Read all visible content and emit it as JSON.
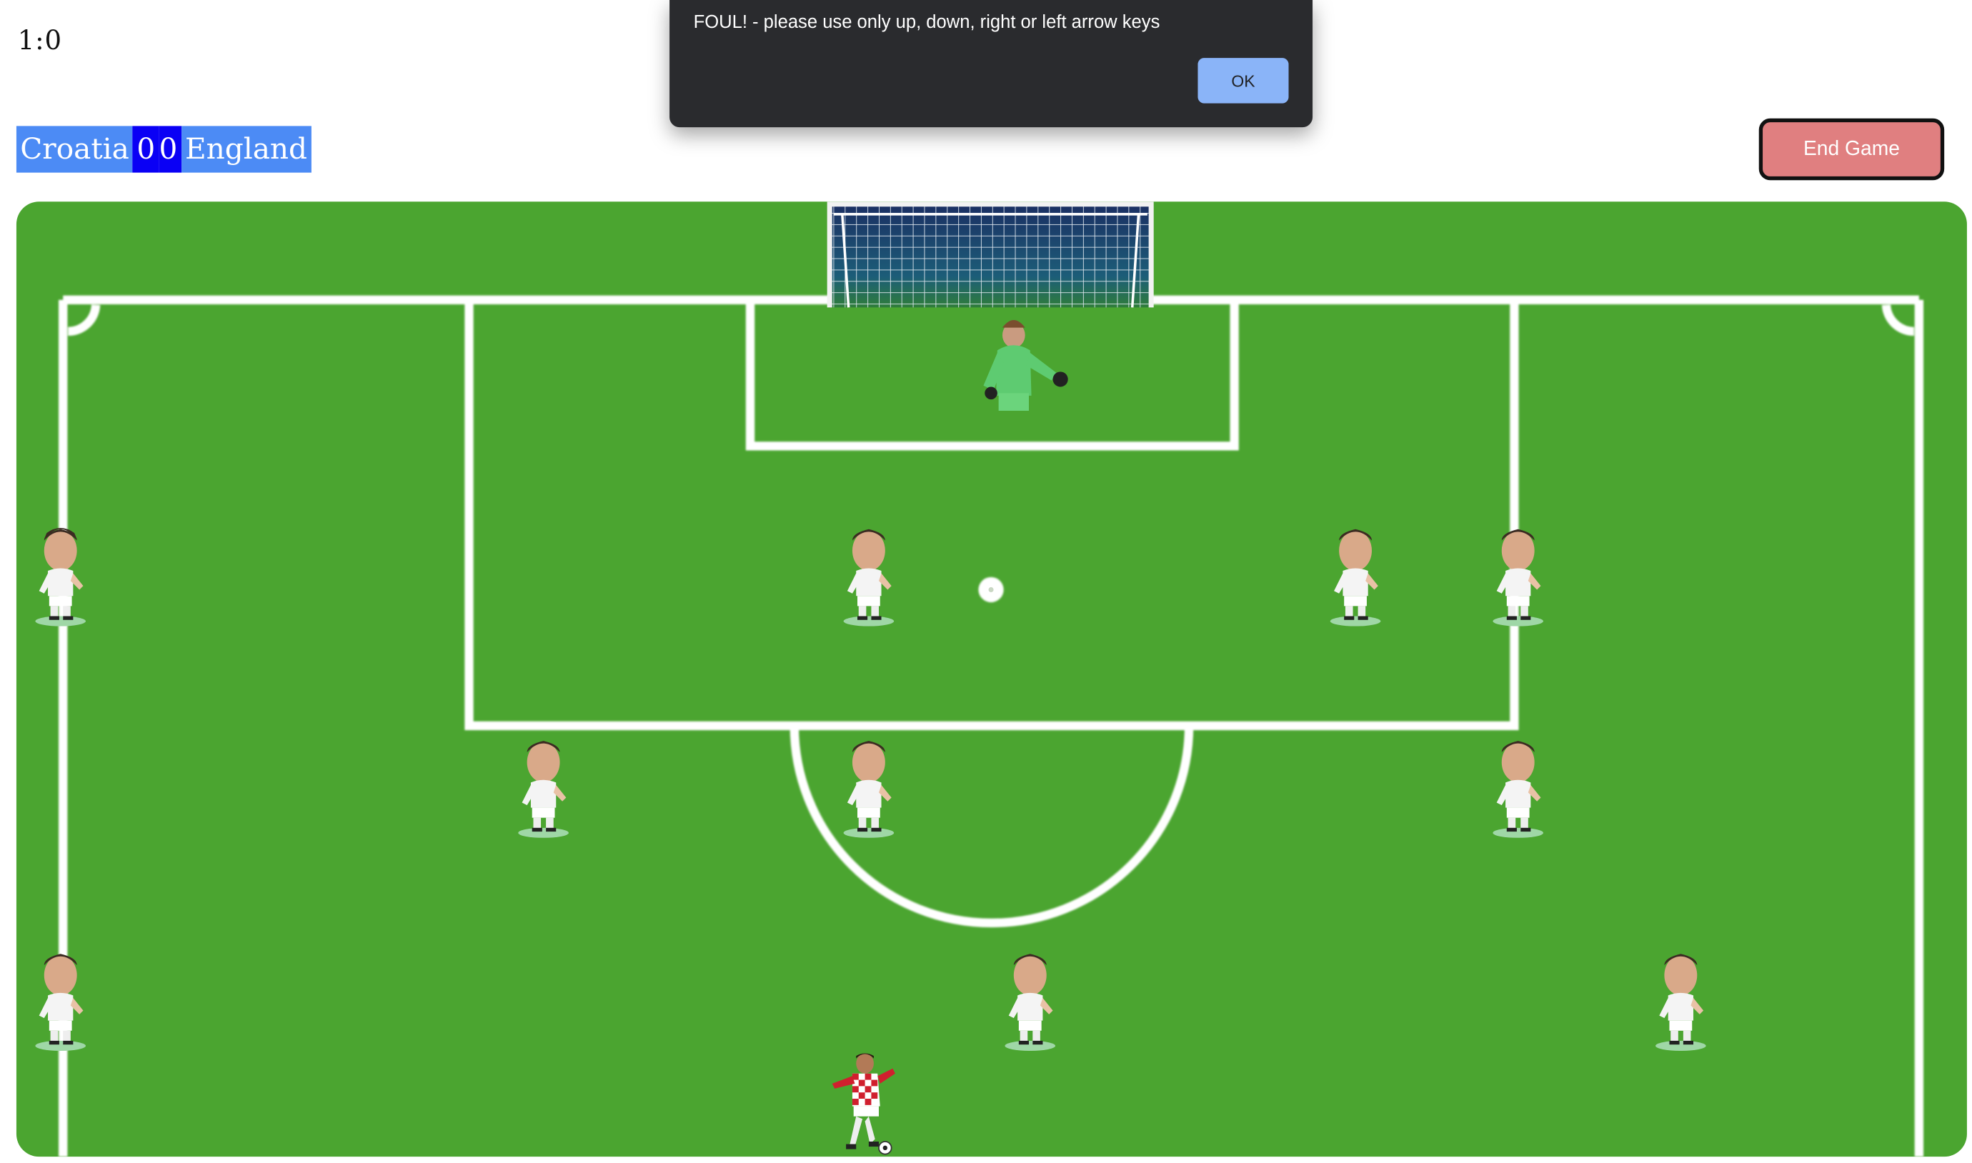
{
  "timer": "1:0",
  "scoreboard": {
    "home_team": "Croatia",
    "home_score": "0",
    "away_score": "0",
    "away_team": "England"
  },
  "end_game_label": "End Game",
  "alert": {
    "message": "FOUL! - please use only up, down, right or left arrow keys",
    "ok_label": "OK"
  },
  "colors": {
    "pitch": "#4ba530",
    "end_button": "#e07f80",
    "scoreboard_team_bg": "#4c8bf5",
    "scoreboard_score_bg": "#0a00f5"
  }
}
